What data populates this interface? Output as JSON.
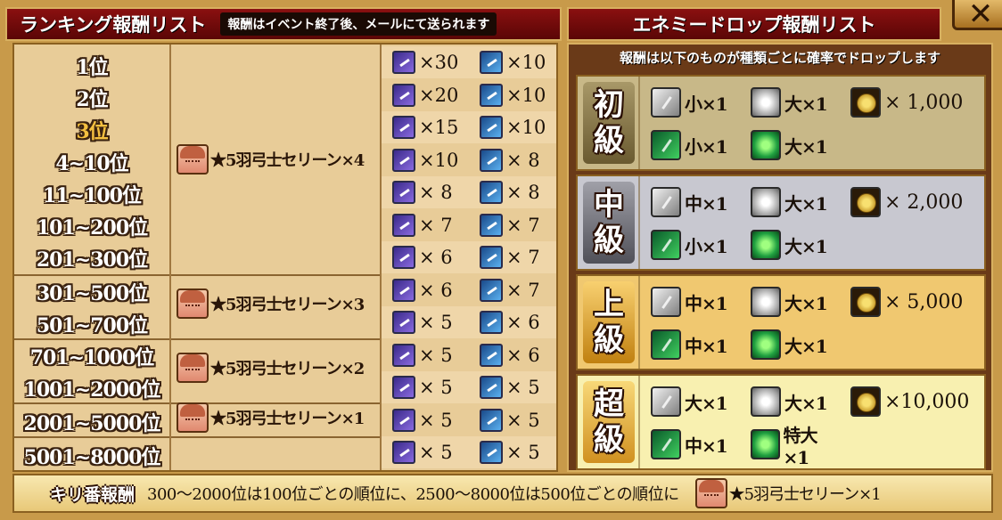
{
  "ranking_header": {
    "title": "ランキング報酬リスト",
    "note": "報酬はイベント終了後、メールにて送られます"
  },
  "drop_header": {
    "title": "エネミードロップ報酬リスト",
    "note": "報酬は以下のものが種類ごとに確率でドロップします"
  },
  "ranks": [
    "1位",
    "2位",
    "3位",
    "4~10位",
    "11~100位",
    "101~200位",
    "201~300位",
    "301~500位",
    "501~700位",
    "701~1000位",
    "1001~2000位",
    "2001~5000位",
    "5001~8000位"
  ],
  "rewards": [
    {
      "label": "★5羽弓士セリーン×4"
    },
    {
      "label": "★5羽弓士セリーン×3"
    },
    {
      "label": "★5羽弓士セリーン×2"
    },
    {
      "label": "★5羽弓士セリーン×1"
    }
  ],
  "items": [
    {
      "purple": "×30",
      "blue": "×10"
    },
    {
      "purple": "×20",
      "blue": "×10"
    },
    {
      "purple": "×15",
      "blue": "×10"
    },
    {
      "purple": "×10",
      "blue": "× 8"
    },
    {
      "purple": "× 8",
      "blue": "× 8"
    },
    {
      "purple": "× 7",
      "blue": "× 7"
    },
    {
      "purple": "× 6",
      "blue": "× 7"
    },
    {
      "purple": "× 6",
      "blue": "× 7"
    },
    {
      "purple": "× 5",
      "blue": "× 6"
    },
    {
      "purple": "× 5",
      "blue": "× 6"
    },
    {
      "purple": "× 5",
      "blue": "× 5"
    },
    {
      "purple": "× 5",
      "blue": "× 5"
    },
    {
      "purple": "× 5",
      "blue": "× 5"
    }
  ],
  "tiers": [
    {
      "label": "初級",
      "row1": [
        "小×1",
        "大×1",
        "× 1,000"
      ],
      "row2": [
        "小×1",
        "大×1"
      ]
    },
    {
      "label": "中級",
      "row1": [
        "中×1",
        "大×1",
        "× 2,000"
      ],
      "row2": [
        "小×1",
        "大×1"
      ]
    },
    {
      "label": "上級",
      "row1": [
        "中×1",
        "大×1",
        "× 5,000"
      ],
      "row2": [
        "中×1",
        "大×1"
      ]
    },
    {
      "label": "超級",
      "row1": [
        "大×1",
        "大×1",
        "×10,000"
      ],
      "row2": [
        "中×1",
        "特大×1"
      ]
    }
  ],
  "bottom": {
    "label": "キリ番報酬",
    "text": "300～2000位は100位ごとの順位に、2500～8000位は500位ごとの順位に",
    "reward": "★5羽弓士セリーン×1"
  },
  "colors": {
    "header_red": "#8a1010",
    "panel_beige": "#e8cc98",
    "tier_beginner": "#c8b888",
    "tier_intermediate": "#c8c8d0",
    "tier_advanced": "#f0c870",
    "tier_super": "#f8f0b0"
  }
}
